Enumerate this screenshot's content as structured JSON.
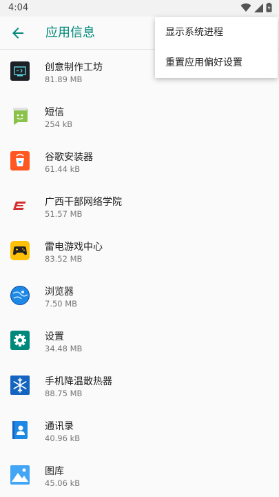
{
  "status": {
    "time": "4:04"
  },
  "header": {
    "title": "应用信息"
  },
  "menu": {
    "items": [
      "显示系统进程",
      "重置应用偏好设置"
    ]
  },
  "apps": [
    {
      "name": "创意制作工坊",
      "size": "81.89 MB",
      "icon": "creative-workshop-icon"
    },
    {
      "name": "短信",
      "size": "254 kB",
      "icon": "messages-icon"
    },
    {
      "name": "谷歌安装器",
      "size": "61.44 kB",
      "icon": "google-installer-icon"
    },
    {
      "name": "广西干部网络学院",
      "size": "51.57 MB",
      "icon": "guangxi-cadre-academy-icon"
    },
    {
      "name": "雷电游戏中心",
      "size": "83.52 MB",
      "icon": "leidian-game-center-icon"
    },
    {
      "name": "浏览器",
      "size": "7.50 MB",
      "icon": "browser-icon"
    },
    {
      "name": "设置",
      "size": "34.48 MB",
      "icon": "settings-icon"
    },
    {
      "name": "手机降温散热器",
      "size": "88.75 MB",
      "icon": "phone-cooler-icon"
    },
    {
      "name": "通讯录",
      "size": "40.96 kB",
      "icon": "contacts-icon"
    },
    {
      "name": "图库",
      "size": "45.06 kB",
      "icon": "gallery-icon"
    }
  ],
  "colors": {
    "accent": "#00897b"
  }
}
